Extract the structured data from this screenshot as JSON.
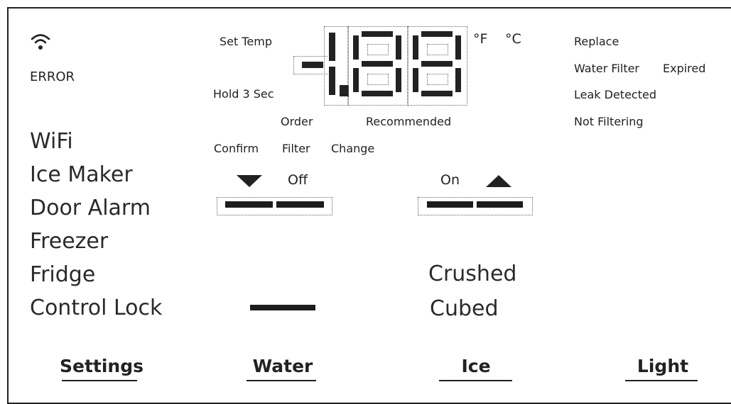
{
  "status": {
    "wifi_icon": "wifi-icon",
    "error": "ERROR"
  },
  "display": {
    "set_temp": "Set Temp",
    "hold": "Hold 3 Sec",
    "unit_f": "°F",
    "unit_c": "°C",
    "readout": "-1.88"
  },
  "filter_status": {
    "replace": "Replace",
    "water_filter": "Water Filter",
    "expired": "Expired",
    "leak": "Leak Detected",
    "not_filtering": "Not Filtering"
  },
  "order": {
    "order": "Order",
    "recommended": "Recommended",
    "confirm": "Confirm",
    "filter": "Filter",
    "change": "Change"
  },
  "menu": {
    "items": [
      "WiFi",
      "Ice Maker",
      "Door Alarm",
      "Freezer",
      "Fridge",
      "Control Lock"
    ]
  },
  "toggles": {
    "off": "Off",
    "on": "On"
  },
  "ice_modes": {
    "crushed": "Crushed",
    "cubed": "Cubed"
  },
  "buttons": {
    "settings": "Settings",
    "water": "Water",
    "ice": "Ice",
    "light": "Light"
  }
}
